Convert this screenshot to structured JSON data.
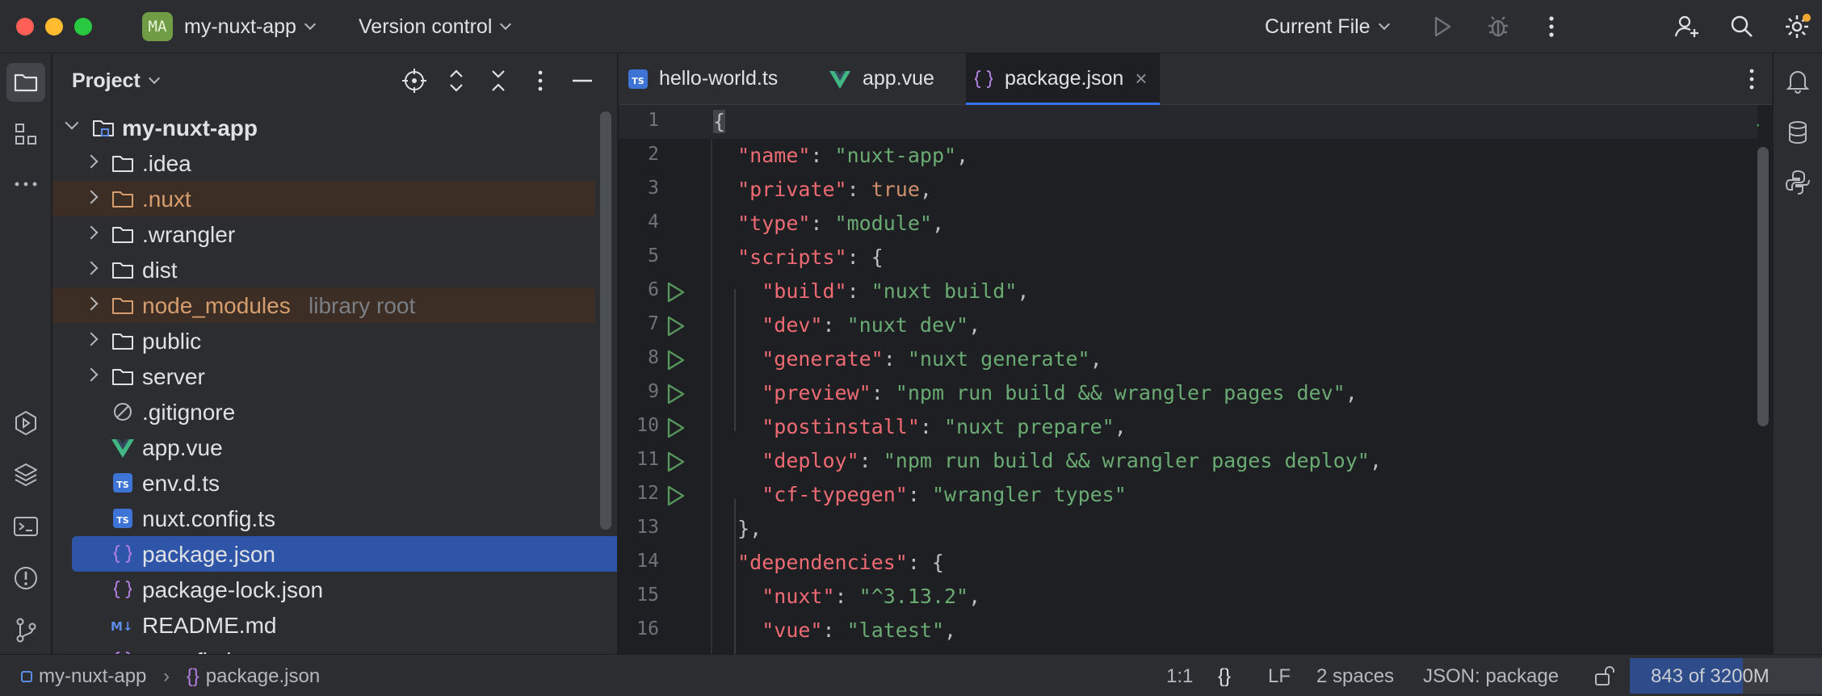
{
  "window": {
    "project_badge": "MA",
    "project_name": "my-nuxt-app",
    "vcs_label": "Version control",
    "run_config": "Current File"
  },
  "project_panel": {
    "title": "Project",
    "tree": [
      {
        "label": "my-nuxt-app",
        "icon": "module-folder-icon",
        "expanded": true
      },
      {
        "label": ".idea",
        "icon": "folder-icon"
      },
      {
        "label": ".nuxt",
        "icon": "folder-icon",
        "excluded": true
      },
      {
        "label": ".wrangler",
        "icon": "folder-icon"
      },
      {
        "label": "dist",
        "icon": "folder-icon"
      },
      {
        "label": "node_modules",
        "extra": "library root",
        "icon": "folder-icon",
        "excluded": true
      },
      {
        "label": "public",
        "icon": "folder-icon"
      },
      {
        "label": "server",
        "icon": "folder-icon"
      },
      {
        "label": ".gitignore",
        "icon": "ignore-file-icon"
      },
      {
        "label": "app.vue",
        "icon": "vue-icon"
      },
      {
        "label": "env.d.ts",
        "icon": "typescript-icon"
      },
      {
        "label": "nuxt.config.ts",
        "icon": "typescript-icon"
      },
      {
        "label": "package.json",
        "icon": "json-icon",
        "selected": true
      },
      {
        "label": "package-lock.json",
        "icon": "json-icon"
      },
      {
        "label": "README.md",
        "icon": "markdown-icon"
      },
      {
        "label": "tsconfig.json",
        "icon": "json-icon"
      }
    ]
  },
  "editor": {
    "tabs": [
      {
        "label": "hello-world.ts",
        "icon": "typescript-icon"
      },
      {
        "label": "app.vue",
        "icon": "vue-icon"
      },
      {
        "label": "package.json",
        "icon": "json-icon",
        "active": true
      }
    ],
    "lines": [
      {
        "n": "1",
        "tokens": [
          [
            "p",
            "{"
          ]
        ]
      },
      {
        "n": "2",
        "tokens": [
          [
            "p",
            "  "
          ],
          [
            "k",
            "\"name\""
          ],
          [
            "p",
            ": "
          ],
          [
            "s",
            "\"nuxt-app\""
          ],
          [
            "p",
            ","
          ]
        ]
      },
      {
        "n": "3",
        "tokens": [
          [
            "p",
            "  "
          ],
          [
            "k",
            "\"private\""
          ],
          [
            "p",
            ": "
          ],
          [
            "kw",
            "true"
          ],
          [
            "p",
            ","
          ]
        ]
      },
      {
        "n": "4",
        "tokens": [
          [
            "p",
            "  "
          ],
          [
            "k",
            "\"type\""
          ],
          [
            "p",
            ": "
          ],
          [
            "s",
            "\"module\""
          ],
          [
            "p",
            ","
          ]
        ]
      },
      {
        "n": "5",
        "tokens": [
          [
            "p",
            "  "
          ],
          [
            "k",
            "\"scripts\""
          ],
          [
            "p",
            ": {"
          ]
        ]
      },
      {
        "n": "6",
        "run": true,
        "tokens": [
          [
            "p",
            "    "
          ],
          [
            "k",
            "\"build\""
          ],
          [
            "p",
            ": "
          ],
          [
            "s",
            "\"nuxt build\""
          ],
          [
            "p",
            ","
          ]
        ]
      },
      {
        "n": "7",
        "run": true,
        "tokens": [
          [
            "p",
            "    "
          ],
          [
            "k",
            "\"dev\""
          ],
          [
            "p",
            ": "
          ],
          [
            "s",
            "\"nuxt dev\""
          ],
          [
            "p",
            ","
          ]
        ]
      },
      {
        "n": "8",
        "run": true,
        "tokens": [
          [
            "p",
            "    "
          ],
          [
            "k",
            "\"generate\""
          ],
          [
            "p",
            ": "
          ],
          [
            "s",
            "\"nuxt generate\""
          ],
          [
            "p",
            ","
          ]
        ]
      },
      {
        "n": "9",
        "run": true,
        "tokens": [
          [
            "p",
            "    "
          ],
          [
            "k",
            "\"preview\""
          ],
          [
            "p",
            ": "
          ],
          [
            "s",
            "\"npm run build && wrangler pages dev\""
          ],
          [
            "p",
            ","
          ]
        ]
      },
      {
        "n": "10",
        "run": true,
        "tokens": [
          [
            "p",
            "    "
          ],
          [
            "k",
            "\"postinstall\""
          ],
          [
            "p",
            ": "
          ],
          [
            "s",
            "\"nuxt prepare\""
          ],
          [
            "p",
            ","
          ]
        ]
      },
      {
        "n": "11",
        "run": true,
        "tokens": [
          [
            "p",
            "    "
          ],
          [
            "k",
            "\"deploy\""
          ],
          [
            "p",
            ": "
          ],
          [
            "s",
            "\"npm run build && wrangler pages deploy\""
          ],
          [
            "p",
            ","
          ]
        ]
      },
      {
        "n": "12",
        "run": true,
        "tokens": [
          [
            "p",
            "    "
          ],
          [
            "k",
            "\"cf-typegen\""
          ],
          [
            "p",
            ": "
          ],
          [
            "s",
            "\"wrangler types\""
          ]
        ]
      },
      {
        "n": "13",
        "tokens": [
          [
            "p",
            "  },"
          ]
        ]
      },
      {
        "n": "14",
        "tokens": [
          [
            "p",
            "  "
          ],
          [
            "k",
            "\"dependencies\""
          ],
          [
            "p",
            ": {"
          ]
        ]
      },
      {
        "n": "15",
        "tokens": [
          [
            "p",
            "    "
          ],
          [
            "k",
            "\"nuxt\""
          ],
          [
            "p",
            ": "
          ],
          [
            "s",
            "\"^3.13.2\""
          ],
          [
            "p",
            ","
          ]
        ]
      },
      {
        "n": "16",
        "tokens": [
          [
            "p",
            "    "
          ],
          [
            "k",
            "\"vue\""
          ],
          [
            "p",
            ": "
          ],
          [
            "s",
            "\"latest\""
          ],
          [
            "p",
            ","
          ]
        ]
      }
    ]
  },
  "status": {
    "breadcrumb_project": "my-nuxt-app",
    "breadcrumb_file": "package.json",
    "position": "1:1",
    "line_sep": "LF",
    "indent": "2 spaces",
    "schema": "JSON: package",
    "memory": "843 of 3200M"
  },
  "colors": {
    "key": "#ef6b73",
    "string": "#6aab73",
    "keyword": "#cf8e6d",
    "accent": "#3574f0",
    "run": "#57965c"
  }
}
